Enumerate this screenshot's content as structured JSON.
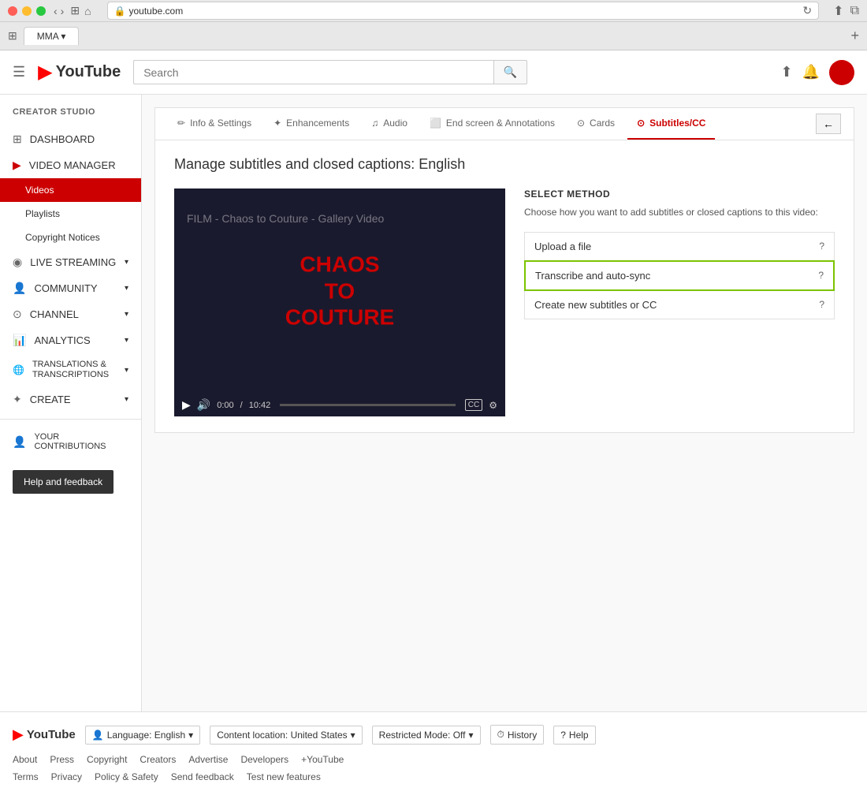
{
  "mac": {
    "url": "youtube.com",
    "tab_title": "MMA ▾"
  },
  "header": {
    "search_placeholder": "Search",
    "hamburger_label": "☰",
    "logo_icon": "▶",
    "logo_text": "YouTube"
  },
  "sidebar": {
    "title": "CREATOR STUDIO",
    "items": [
      {
        "id": "dashboard",
        "label": "DASHBOARD",
        "icon": "⊞"
      },
      {
        "id": "video-manager",
        "label": "VIDEO MANAGER",
        "icon": "▶",
        "active": false
      },
      {
        "id": "videos",
        "label": "Videos",
        "sub": true,
        "active": true
      },
      {
        "id": "playlists",
        "label": "Playlists",
        "sub": true
      },
      {
        "id": "copyright-notices",
        "label": "Copyright Notices",
        "sub": true
      },
      {
        "id": "live-streaming",
        "label": "LIVE STREAMING",
        "icon": "◉",
        "expandable": true
      },
      {
        "id": "community",
        "label": "COMMUNITY",
        "icon": "👤",
        "expandable": true
      },
      {
        "id": "channel",
        "label": "CHANNEL",
        "icon": "⊙",
        "expandable": true
      },
      {
        "id": "analytics",
        "label": "ANALYTICS",
        "icon": "📊",
        "expandable": true
      },
      {
        "id": "translations",
        "label": "TRANSLATIONS & TRANSCRIPTIONS",
        "icon": "🌐",
        "expandable": true
      },
      {
        "id": "create",
        "label": "CREATE",
        "icon": "✦",
        "expandable": true
      },
      {
        "id": "your-contributions",
        "label": "YOUR CONTRIBUTIONS",
        "icon": "👤"
      }
    ],
    "help_btn": "Help and feedback"
  },
  "panel": {
    "tabs": [
      {
        "id": "info-settings",
        "label": "Info & Settings",
        "icon": "✏"
      },
      {
        "id": "enhancements",
        "label": "Enhancements",
        "icon": "✦"
      },
      {
        "id": "audio",
        "label": "Audio",
        "icon": "♫"
      },
      {
        "id": "end-screen",
        "label": "End screen & Annotations",
        "icon": "⬜"
      },
      {
        "id": "cards",
        "label": "Cards",
        "icon": "⊙"
      },
      {
        "id": "subtitles",
        "label": "Subtitles/CC",
        "icon": "⊙",
        "active": true
      }
    ],
    "back_btn": "←"
  },
  "page": {
    "title": "Manage subtitles and closed captions: English",
    "video": {
      "overlay_text": "FILM - Chaos to Couture - Gallery Video",
      "center_line1": "CHAOS",
      "center_line2": "TO",
      "center_line3": "COUTURE",
      "time_current": "0:00",
      "time_total": "10:42"
    },
    "select_method": {
      "title": "SELECT METHOD",
      "description": "Choose how you want to add subtitles or closed captions to this video:",
      "options": [
        {
          "id": "upload-file",
          "label": "Upload a file",
          "highlighted": false
        },
        {
          "id": "transcribe-autosync",
          "label": "Transcribe and auto-sync",
          "highlighted": true
        },
        {
          "id": "create-new",
          "label": "Create new subtitles or CC",
          "highlighted": false
        }
      ]
    }
  },
  "footer": {
    "logo_icon": "▶",
    "logo_text": "YouTube",
    "language_label": "Language: English",
    "content_location_label": "Content location: United States",
    "restricted_mode_label": "Restricted Mode: Off",
    "history_label": "History",
    "help_label": "Help",
    "links": [
      "About",
      "Press",
      "Copyright",
      "Creators",
      "Advertise",
      "Developers",
      "+YouTube"
    ],
    "bottom_links": [
      "Terms",
      "Privacy",
      "Policy & Safety",
      "Send feedback",
      "Test new features"
    ]
  }
}
